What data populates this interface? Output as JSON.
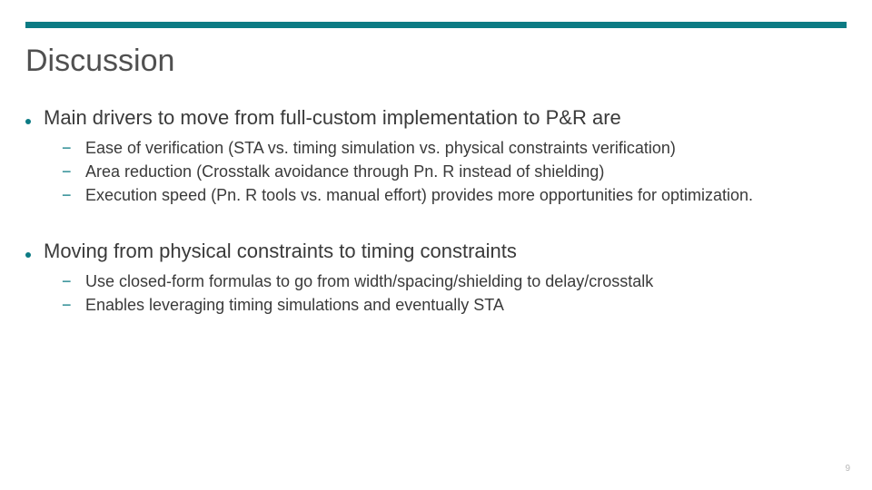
{
  "title": "Discussion",
  "bullets": [
    {
      "text": "Main drivers to move from full-custom implementation to P&R are",
      "subs": [
        "Ease of verification (STA vs. timing simulation vs. physical constraints verification)",
        "Area reduction (Crosstalk avoidance through Pn. R instead of shielding)",
        "Execution speed (Pn. R tools vs. manual effort) provides more opportunities for optimization."
      ]
    },
    {
      "text": "Moving from physical constraints to timing constraints",
      "subs": [
        "Use closed-form formulas to go from width/spacing/shielding to delay/crosstalk",
        "Enables leveraging timing simulations and eventually STA"
      ]
    }
  ],
  "pageNumber": "9",
  "colors": {
    "accent": "#0c7b84"
  }
}
